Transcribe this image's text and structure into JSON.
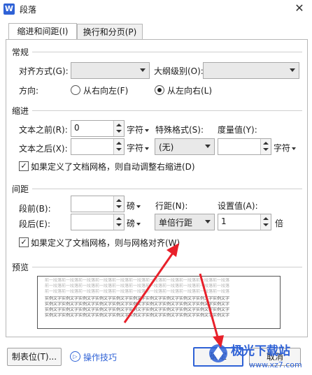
{
  "window": {
    "app_icon_letter": "W",
    "title": "段落",
    "close_symbol": "✕"
  },
  "tabs": [
    {
      "label": "缩进和间距(I)",
      "active": true
    },
    {
      "label": "换行和分页(P)",
      "active": false
    }
  ],
  "general": {
    "section_title": "常规",
    "alignment_label": "对齐方式(G):",
    "alignment_value": "",
    "outline_label": "大纲级别(O):",
    "outline_value": "",
    "direction_label": "方向:",
    "rtl_label": "从右向左(F)",
    "ltr_label": "从左向右(L)",
    "selected_direction": "ltr"
  },
  "indent": {
    "section_title": "缩进",
    "before_label": "文本之前(R):",
    "before_value": "0",
    "before_unit": "字符",
    "after_label": "文本之后(X):",
    "after_value": "",
    "after_unit": "字符",
    "special_label": "特殊格式(S):",
    "special_value": "(无)",
    "measure_label": "度量值(Y):",
    "measure_value": "",
    "measure_unit": "字符",
    "auto_adjust_label": "如果定义了文档网格，则自动调整右缩进(D)",
    "auto_adjust_checked": true
  },
  "spacing": {
    "section_title": "间距",
    "before_label": "段前(B):",
    "before_value": "",
    "before_unit": "磅",
    "after_label": "段后(E):",
    "after_value": "",
    "after_unit": "磅",
    "line_label": "行距(N):",
    "line_value": "单倍行距",
    "setting_label": "设置值(A):",
    "setting_value": "1",
    "setting_unit": "倍",
    "snap_label": "如果定义了文档网格，则与网格对齐(W)",
    "snap_checked": true
  },
  "preview": {
    "section_title": "预览",
    "grey_lines": [
      "前一段落前一段落前一段落前一段落前一段落前一段落前一段落前一段落前一段落前一段落前一段落",
      "前一段落前一段落前一段落前一段落前一段落前一段落前一段落前一段落前一段落前一段落前一段落",
      "前一段落前一段落前一段落前一段落前一段落前一段落前一段落前一段落前一段落前一段落前一段落"
    ],
    "dark_lines": [
      "实例文字实例文字实例文字实例文字实例文字实例文字实例文字实例文字实例文字实例文字实例文字",
      "实例文字实例文字实例文字实例文字实例文字实例文字实例文字实例文字实例文字实例文字实例文字",
      "实例文字实例文字实例文字实例文字实例文字实例文字实例文字实例文字实例文字实例文字实例文字",
      "实例文字实例文字实例文字实例文字实例文字实例文字实例文字实例文字实例文字实例文字实例文字"
    ]
  },
  "footer": {
    "tabs_button": "制表位(T)...",
    "tips_icon_symbol": "▷",
    "tips_link": "操作技巧",
    "ok_button": "确定",
    "cancel_button": "取消"
  },
  "watermark": {
    "text": "极光下载站",
    "url": "www.xz7.com"
  },
  "colors": {
    "accent": "#2f62d6",
    "arrow": "#e8202a"
  }
}
